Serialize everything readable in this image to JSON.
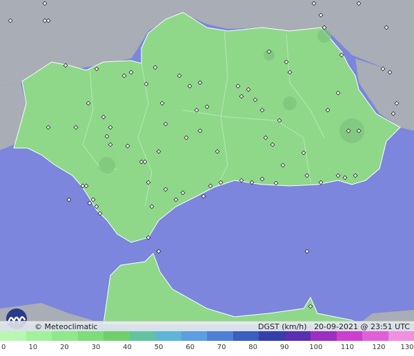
{
  "map": {
    "sea_color": "#7b86dc",
    "land_color": "#8fd88a",
    "outside_color": "#a9adb5"
  },
  "footer": {
    "credit": "© Meteoclimatic",
    "variable": "DGST (km/h)",
    "datetime": "20-09-2021 @ 23:51 UTC"
  },
  "legend": {
    "ticks": [
      "0",
      "10",
      "20",
      "30",
      "40",
      "50",
      "60",
      "70",
      "80",
      "90",
      "100",
      "110",
      "120",
      "130"
    ],
    "colors": [
      "#b8f7b0",
      "#a3f09c",
      "#8fe889",
      "#7edd78",
      "#6fd06b",
      "#62c3a0",
      "#5db6d4",
      "#5a9fe0",
      "#4d7fd4",
      "#3b5fbf",
      "#3440a8",
      "#5a2fb0",
      "#9a2fc0",
      "#cc3fcf",
      "#e060d8",
      "#f090e0"
    ]
  }
}
